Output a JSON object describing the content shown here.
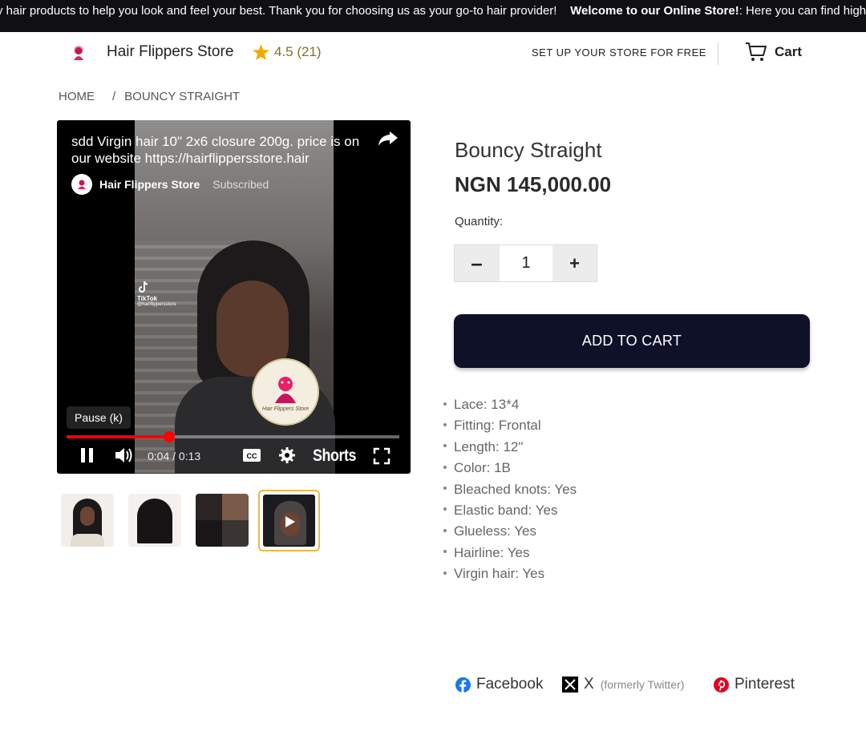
{
  "ticker": {
    "text_a": "y hair products to help you look and feel your best. Thank you for choosing us as your go-to hair provider!",
    "text_b_bold": "Welcome to our Online Store!",
    "text_c": ": Here you can find high-"
  },
  "header": {
    "store_name": "Hair Flippers Store",
    "rating": "4.5 (21)",
    "setup_link": "SET UP YOUR STORE FOR FREE",
    "cart_label": "Cart"
  },
  "breadcrumb": {
    "home": "HOME",
    "separator": "/",
    "current": "BOUNCY STRAIGHT"
  },
  "video": {
    "title": "sdd Virgin hair 10\" 2x6 closure 200g. price is on our website https://hairflippersstore.hair",
    "channel": "Hair Flippers Store",
    "subscribed": "Subscribed",
    "tiktok": "TikTok",
    "tiktok_handle": "@hairflippersstore",
    "pause_tooltip": "Pause (k)",
    "time": "0:04 / 0:13",
    "progress_fraction": 0.3077,
    "shorts_label": "Shorts"
  },
  "thumbnails": [
    {
      "name": "thumb-front-view"
    },
    {
      "name": "thumb-back-view"
    },
    {
      "name": "thumb-closeup-view"
    },
    {
      "name": "thumb-video",
      "active": true
    }
  ],
  "product": {
    "title": "Bouncy Straight",
    "price": "NGN 145,000.00",
    "quantity_label": "Quantity:",
    "quantity_value": "1",
    "minus": "–",
    "plus": "+",
    "add_to_cart": "ADD TO CART",
    "specs": [
      "Lace: 13*4",
      "Fitting: Frontal",
      "Length: 12\"",
      "Color: 1B",
      "Bleached knots: Yes",
      "Elastic band: Yes",
      "Glueless: Yes",
      "Hairline: Yes",
      "Virgin hair: Yes"
    ]
  },
  "share": {
    "facebook": "Facebook",
    "x": "X",
    "x_note": "(formerly Twitter)",
    "pinterest": "Pinterest"
  },
  "colors": {
    "ticker_bg": "#101014",
    "add_to_cart_bg": "#0e1128",
    "star": "#f2a900",
    "progress": "#ff0000",
    "thumb_active_border": "#e9b94a",
    "facebook": "#1877f2",
    "pinterest": "#e60023"
  }
}
